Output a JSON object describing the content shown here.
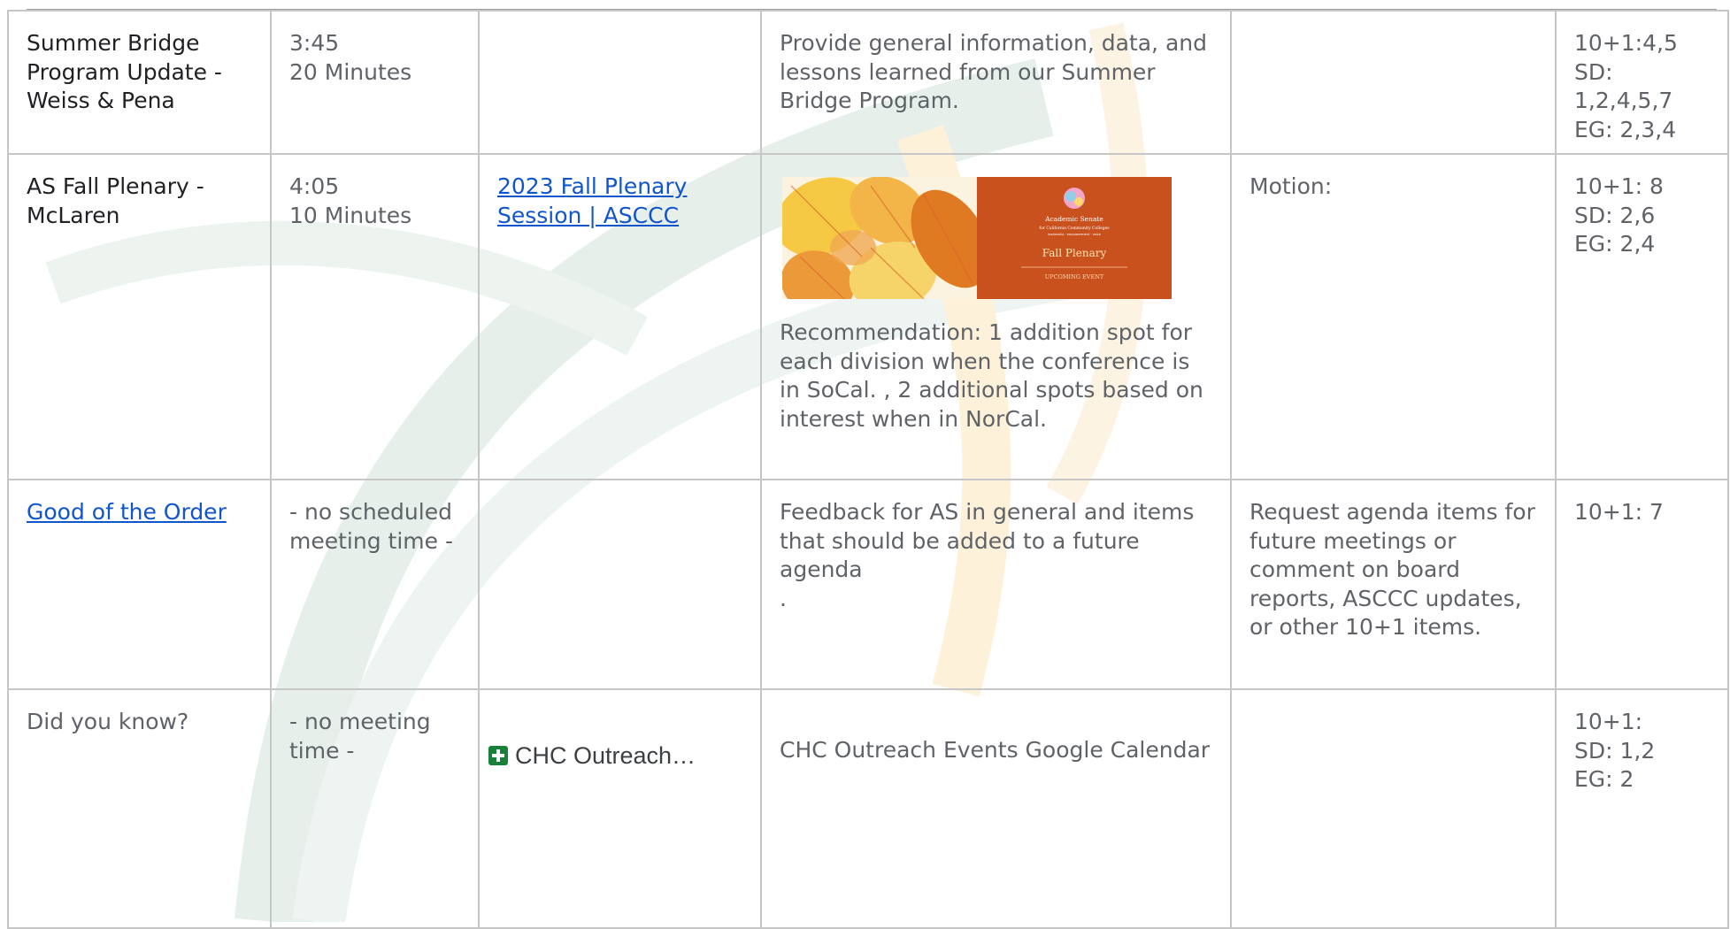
{
  "rows": [
    {
      "topic": "Summer Bridge Program Update - Weiss & Pena",
      "time": "3:45",
      "duration": "20 Minutes",
      "purpose": "Provide general information, data, and lessons learned from our Summer Bridge Program.",
      "standards": "10+1:4,5\nSD: 1,2,4,5,7\nEG: 2,3,4"
    },
    {
      "topic": "AS Fall Plenary - McLaren",
      "time": "4:05",
      "duration": "10 Minutes",
      "link_text": "2023 Fall Plenary Session | ASCCC",
      "banner": {
        "org_line1": "Academic Senate",
        "org_line2": "for California Community Colleges",
        "org_line3": "leadership · empowerment · voice",
        "event": "Fall Plenary",
        "tag": "UPCOMING EVENT",
        "colors": {
          "orange": "#c9511e",
          "leaf_light": "#f6c944",
          "leaf_dark": "#e07a22",
          "paper": "#fbf3df"
        }
      },
      "purpose": "Recommendation: 1 addition spot for each division when the conference is in SoCal. , 2 additional spots based on interest when in NorCal.",
      "action": "Motion:",
      "standards": "10+1: 8\nSD: 2,6\nEG: 2,4"
    },
    {
      "topic": "Good of the Order",
      "time": "- no scheduled meeting time -",
      "purpose": "Feedback for AS in general and items that should be added to a future agenda\n.",
      "action": "Request agenda items for future meetings or comment on board reports, ASCCC updates, or other 10+1 items.",
      "standards": "10+1: 7"
    },
    {
      "topic": "Did you know?",
      "time": "- no meeting time -",
      "chip_text": "CHC Outreach…",
      "chip_icon": "google-sheets-icon",
      "purpose": "CHC Outreach Events Google Calendar",
      "standards": "10+1:\nSD: 1,2\nEG: 2"
    }
  ],
  "colors": {
    "border": "#c6c6c6",
    "text_dark": "#202124",
    "text_gray": "#5f6368",
    "link": "#1155cc",
    "watermark_teal": "#e7efeb",
    "watermark_gold": "#fdf1d9"
  }
}
